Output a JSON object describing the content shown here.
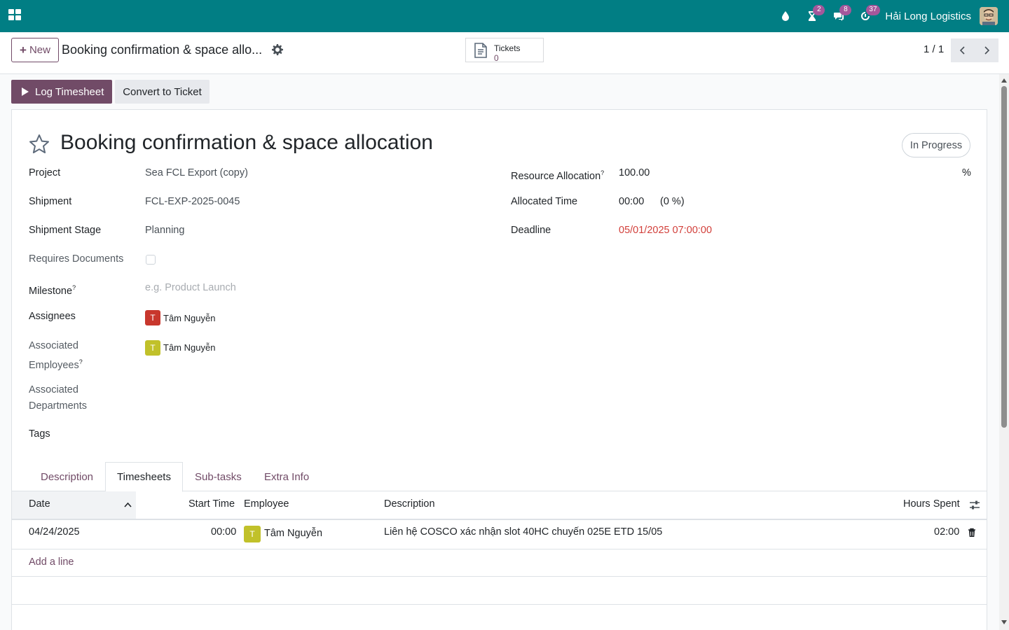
{
  "navbar": {
    "company": "Hải Long Logistics",
    "badges": {
      "activities": "2",
      "messages": "8",
      "timer": "37"
    },
    "accent": "#017e84"
  },
  "control": {
    "new_label": "New",
    "breadcrumb": "Booking confirmation & space allo...",
    "smart_button": {
      "label": "Tickets",
      "value": "0"
    },
    "pager": "1 / 1"
  },
  "actions": {
    "log_timesheet": "Log Timesheet",
    "convert_ticket": "Convert to Ticket"
  },
  "task": {
    "title": "Booking confirmation & space allocation",
    "status": "In Progress"
  },
  "fields_left": {
    "project_label": "Project",
    "project_value": "Sea FCL Export (copy)",
    "shipment_label": "Shipment",
    "shipment_value": "FCL-EXP-2025-0045",
    "stage_label": "Shipment Stage",
    "stage_value": "Planning",
    "requires_docs_label": "Requires Documents",
    "milestone_label": "Milestone",
    "milestone_placeholder": "e.g. Product Launch",
    "assignees_label": "Assignees",
    "assignee_initial": "T",
    "assignee_name": "Tâm Nguyễn",
    "assoc_emp_label_1": "Associated",
    "assoc_emp_label_2": "Employees",
    "assoc_emp_initial": "T",
    "assoc_emp_name": "Tâm Nguyễn",
    "assoc_dept_label_1": "Associated",
    "assoc_dept_label_2": "Departments",
    "tags_label": "Tags",
    "help_mark": "?"
  },
  "fields_right": {
    "resource_label": "Resource Allocation",
    "resource_value": "100.00",
    "resource_unit": "%",
    "allocated_label": "Allocated Time",
    "allocated_value": "00:00",
    "allocated_pct": "(0 %)",
    "deadline_label": "Deadline",
    "deadline_value": "05/01/2025 07:00:00"
  },
  "tabs": [
    "Description",
    "Timesheets",
    "Sub-tasks",
    "Extra Info"
  ],
  "timesheet": {
    "headers": {
      "date": "Date",
      "start": "Start Time",
      "employee": "Employee",
      "description": "Description",
      "hours": "Hours Spent"
    },
    "rows": [
      {
        "date": "04/24/2025",
        "start": "00:00",
        "employee_initial": "T",
        "employee": "Tâm Nguyễn",
        "description": "Liên hệ COSCO xác nhận slot 40HC chuyến 025E ETD 15/05",
        "hours": "02:00"
      }
    ],
    "add_line": "Add a line"
  }
}
